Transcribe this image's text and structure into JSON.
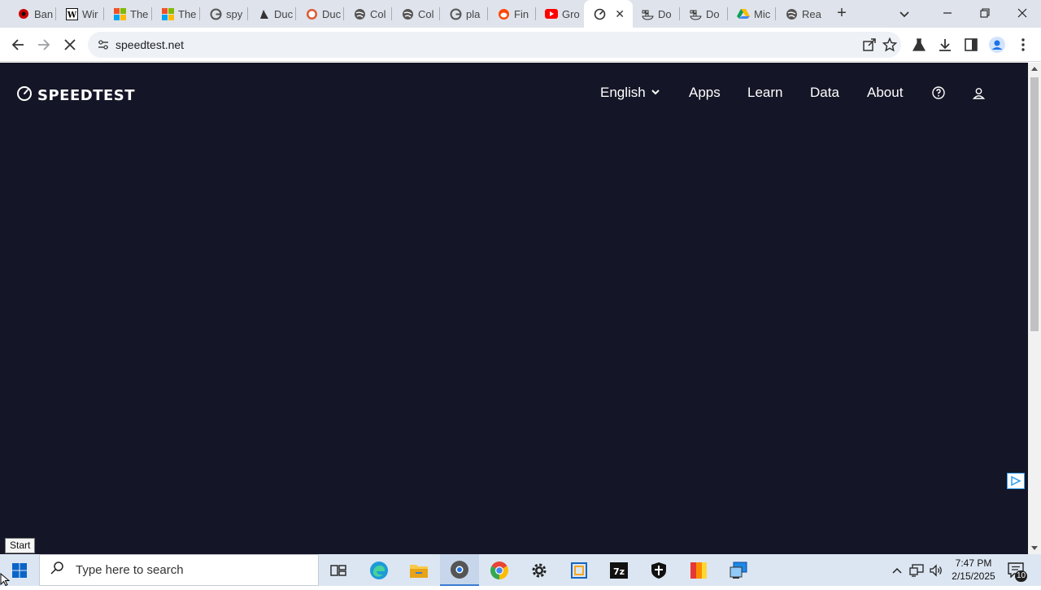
{
  "browser": {
    "tabs": [
      {
        "label": "Ban",
        "icon": "red-circle-icon"
      },
      {
        "label": "Wir",
        "icon": "wikipedia-icon"
      },
      {
        "label": "The",
        "icon": "microsoft-icon"
      },
      {
        "label": "The",
        "icon": "microsoft-icon"
      },
      {
        "label": "spy",
        "icon": "google-icon"
      },
      {
        "label": "Duc",
        "icon": "duck-icon"
      },
      {
        "label": "Duc",
        "icon": "duckduckgo-icon"
      },
      {
        "label": "Col",
        "icon": "globe-icon"
      },
      {
        "label": "Col",
        "icon": "globe-icon"
      },
      {
        "label": "pla",
        "icon": "google-icon"
      },
      {
        "label": "Fin",
        "icon": "reddit-icon"
      },
      {
        "label": "Gro",
        "icon": "youtube-icon"
      },
      {
        "label": "",
        "icon": "speedtest-icon",
        "active": true
      },
      {
        "label": "Do",
        "icon": "docker-icon"
      },
      {
        "label": "Do",
        "icon": "docker-icon"
      },
      {
        "label": "Mic",
        "icon": "google-drive-icon"
      },
      {
        "label": "Rea",
        "icon": "globe-icon"
      }
    ],
    "url": "speedtest.net"
  },
  "site": {
    "logo": "SPEEDTEST",
    "nav": {
      "language": "English",
      "apps": "Apps",
      "learn": "Learn",
      "data": "Data",
      "about": "About"
    }
  },
  "tooltip": "Start",
  "taskbar": {
    "search_placeholder": "Type here to search",
    "time": "7:47 PM",
    "date": "2/15/2025",
    "notification_count": "10"
  },
  "colors": {
    "page_bg": "#141526",
    "tabstrip_bg": "#dfe3eb",
    "taskbar_bg": "#dce6f2"
  }
}
